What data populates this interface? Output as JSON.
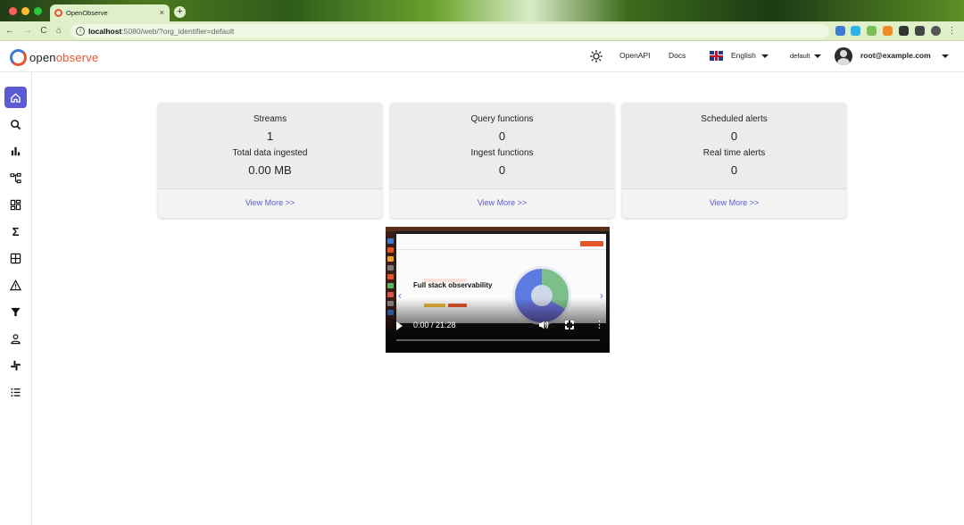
{
  "browser": {
    "tab_title": "OpenObserve",
    "tab_close": "×",
    "new_tab": "+",
    "url_host": "localhost",
    "url_path": ":5080/web/?org_identifier=default",
    "back": "←",
    "forward": "→",
    "reload": "C",
    "home": "⌂"
  },
  "header": {
    "logo_part1": "open",
    "logo_part2": "observe",
    "openapi": "OpenAPI",
    "docs": "Docs",
    "language": "English",
    "org": "default",
    "user": "root@example.com"
  },
  "sidebar": {
    "items": [
      {
        "name": "home",
        "active": true
      },
      {
        "name": "search"
      },
      {
        "name": "metrics"
      },
      {
        "name": "traces"
      },
      {
        "name": "dashboards"
      },
      {
        "name": "functions"
      },
      {
        "name": "streams"
      },
      {
        "name": "alerts"
      },
      {
        "name": "ingestion"
      },
      {
        "name": "iam"
      },
      {
        "name": "slack"
      },
      {
        "name": "about"
      }
    ]
  },
  "cards": [
    {
      "label1": "Streams",
      "value1": "1",
      "label2": "Total data ingested",
      "value2": "0.00 MB",
      "link": "View More >>"
    },
    {
      "label1": "Query functions",
      "value1": "0",
      "label2": "Ingest functions",
      "value2": "0",
      "link": "View More >>"
    },
    {
      "label1": "Scheduled alerts",
      "value1": "0",
      "label2": "Real time alerts",
      "value2": "0",
      "link": "View More >>"
    }
  ],
  "video": {
    "headline": "Full stack observability",
    "time": "0:00 / 21:28",
    "more": "⋮"
  },
  "colors": {
    "accent": "#5b5bd6",
    "brand_orange": "#e6542b",
    "card_bg": "#ececec",
    "chrome_bar": "#dff0c9"
  }
}
